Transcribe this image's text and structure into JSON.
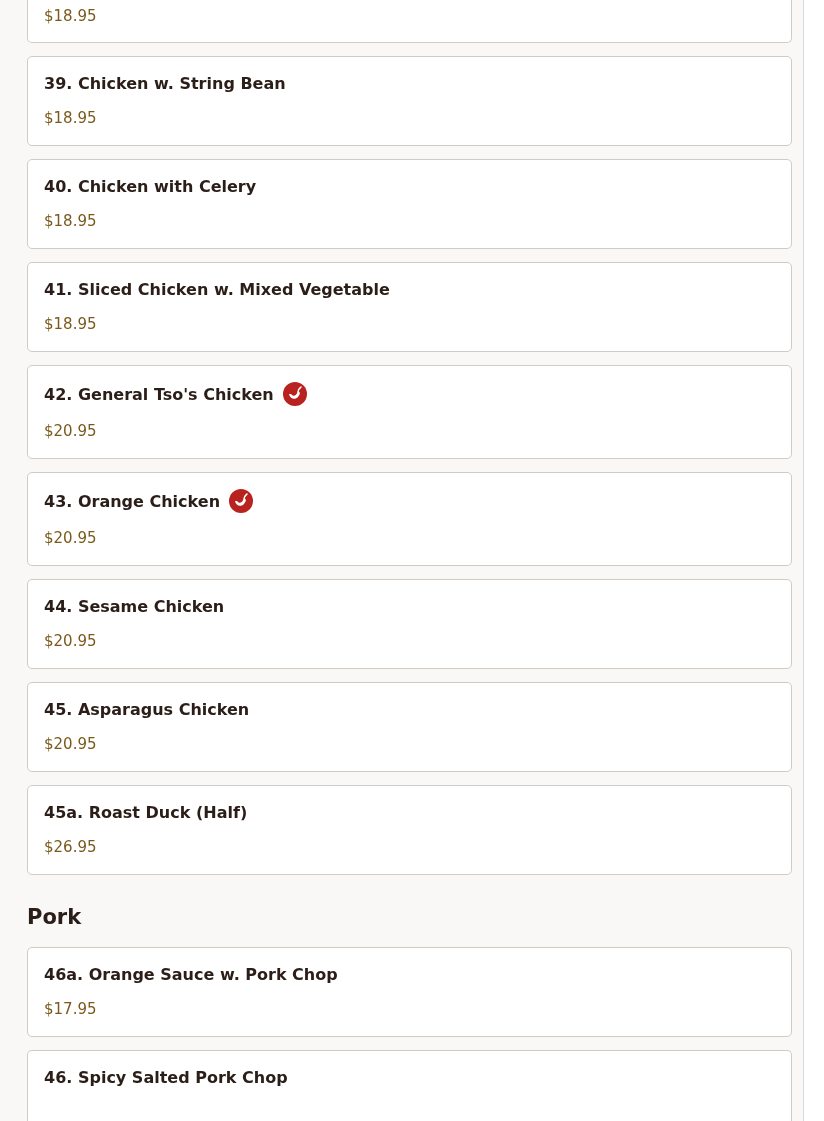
{
  "sections": [
    {
      "items": [
        {
          "price": "$18.95"
        },
        {
          "name": "39. Chicken w. String Bean",
          "price": "$18.95",
          "spicy": false
        },
        {
          "name": "40. Chicken with Celery",
          "price": "$18.95",
          "spicy": false
        },
        {
          "name": "41. Sliced Chicken w. Mixed Vegetable",
          "price": "$18.95",
          "spicy": false
        },
        {
          "name": "42. General Tso's Chicken",
          "price": "$20.95",
          "spicy": true
        },
        {
          "name": "43. Orange Chicken",
          "price": "$20.95",
          "spicy": true
        },
        {
          "name": "44. Sesame Chicken",
          "price": "$20.95",
          "spicy": false
        },
        {
          "name": "45. Asparagus Chicken",
          "price": "$20.95",
          "spicy": false
        },
        {
          "name": "45a. Roast Duck (Half)",
          "price": "$26.95",
          "spicy": false
        }
      ]
    },
    {
      "heading": "Pork",
      "items": [
        {
          "name": "46a. Orange Sauce w. Pork Chop",
          "price": "$17.95",
          "spicy": false
        },
        {
          "name": "46. Spicy Salted Pork Chop",
          "spicy": false
        }
      ]
    }
  ]
}
